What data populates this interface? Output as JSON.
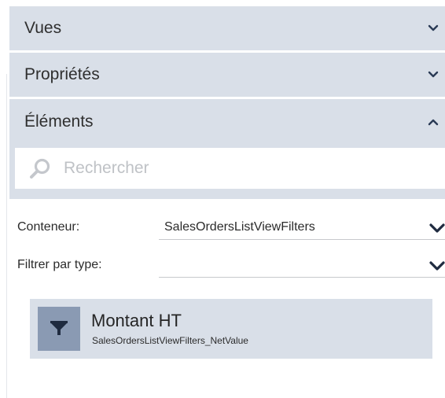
{
  "accordion": {
    "views_label": "Vues",
    "properties_label": "Propriétés",
    "elements_label": "Éléments"
  },
  "search": {
    "placeholder": "Rechercher",
    "value": ""
  },
  "filters": {
    "container_label": "Conteneur:",
    "container_value": "SalesOrdersListViewFilters",
    "type_label": "Filtrer par type:",
    "type_value": ""
  },
  "items": [
    {
      "icon": "filter-funnel-icon",
      "title": "Montant HT",
      "subtitle": "SalesOrdersListViewFilters_NetValue"
    }
  ],
  "colors": {
    "header_bg": "#d9dfe8",
    "item_icon_bg": "#8a9ab3",
    "chevron": "#2a3a55",
    "dropdown_arrow": "#1f2b40"
  }
}
